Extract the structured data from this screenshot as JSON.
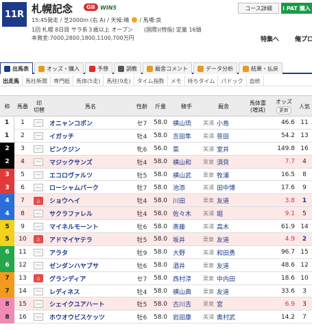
{
  "race": {
    "number": "11R",
    "title": "札幌記念",
    "grade": "GII",
    "win5": "WIN5",
    "meta_line1": "15:45発走 / 芝2000m (右 A) / 天候:晴",
    "meta_weather_tail": "/ 馬場:良",
    "meta_line2": "1回 札幌 8日目 サラ系３歳以上 オープン　　(国際)(特指) 定量 16頭",
    "meta_line3": "本賞金:7000,2800,1800,1100,700万円"
  },
  "header_buttons": {
    "course": "コース詳細",
    "ipat": "i PAT 購入"
  },
  "header_links": {
    "tokusyu": "特集へ",
    "ore": "俺プロ"
  },
  "tabs": [
    {
      "label": "出馬表",
      "icon": "table-icon",
      "color": "#1d3a8a",
      "active": true
    },
    {
      "label": "オッズ・購入",
      "icon": "odds-icon",
      "color": "#e89a1b",
      "active": false
    },
    {
      "label": "予想",
      "icon": "target-icon",
      "color": "#d92e2e",
      "active": false
    },
    {
      "label": "調教",
      "icon": "stopwatch-icon",
      "color": "#555555",
      "active": false
    },
    {
      "label": "厩舎コメント",
      "icon": "comment-icon",
      "color": "#e89a1b",
      "active": false
    },
    {
      "label": "データ分析",
      "icon": "chart-icon",
      "color": "#e89a1b",
      "active": false
    },
    {
      "label": "結果・払戻",
      "icon": "coin-icon",
      "color": "#e89a1b",
      "active": false
    }
  ],
  "subtabs": [
    "出走馬",
    "馬柱新聞",
    "専門紙",
    "馬体(5走)",
    "馬柱(9走)",
    "タイム指数",
    "メモ",
    "持ちタイム",
    "パドック",
    "血統"
  ],
  "columns": {
    "waku": "枠",
    "uma": "馬番",
    "mark": "印",
    "mark_sub": "切替",
    "name": "馬名",
    "sex": "性齢",
    "weight": "斤量",
    "jockey": "騎手",
    "stable": "厩舎",
    "body": "馬体重",
    "body_sub": "(増減)",
    "odds": "オッズ",
    "odds_btn": "更新",
    "pop": "人気"
  },
  "colors": {
    "waku": [
      "#ffffff",
      "#000000",
      "#e03a3a",
      "#2a6ed8",
      "#f2d21b",
      "#24a64a",
      "#f29a1b",
      "#f08cb4"
    ],
    "waku_text": [
      "#222222",
      "#ffffff",
      "#ffffff",
      "#ffffff",
      "#222222",
      "#ffffff",
      "#222222",
      "#222222"
    ]
  },
  "horses": [
    {
      "waku": 1,
      "uma": "1",
      "name": "オニャンコポン",
      "sex": "セ7",
      "wt": "58.0",
      "jockey": "横山琉",
      "aff": "美浦",
      "trainer": "小島",
      "odds": "46.6",
      "pop": "11",
      "hl": false,
      "priority": false,
      "hot": false
    },
    {
      "waku": 1,
      "uma": "2",
      "name": "イガッチ",
      "sex": "牡4",
      "wt": "58.0",
      "jockey": "吉田隼",
      "aff": "美浦",
      "trainer": "笹田",
      "odds": "54.2",
      "pop": "13",
      "hl": false,
      "priority": false,
      "hot": false
    },
    {
      "waku": 2,
      "uma": "3",
      "name": "ピンクジン",
      "sex": "牝6",
      "wt": "56.0",
      "jockey": "菜",
      "aff": "美浦",
      "trainer": "室井",
      "odds": "149.8",
      "pop": "16",
      "hl": false,
      "priority": false,
      "hot": false
    },
    {
      "waku": 2,
      "uma": "4",
      "name": "マジックサンズ",
      "sex": "牡4",
      "wt": "58.0",
      "jockey": "横山和",
      "aff": "栗東",
      "trainer": "須貝",
      "odds": "7.7",
      "pop": "4",
      "hl": true,
      "priority": false,
      "hot": true
    },
    {
      "waku": 3,
      "uma": "5",
      "name": "エコロヴァルツ",
      "sex": "牡5",
      "wt": "58.0",
      "jockey": "横山武",
      "aff": "栗東",
      "trainer": "牧浦",
      "odds": "16.5",
      "pop": "8",
      "hl": false,
      "priority": false,
      "hot": false
    },
    {
      "waku": 3,
      "uma": "6",
      "name": "ローシャムパーク",
      "sex": "牡7",
      "wt": "58.0",
      "jockey": "池添",
      "aff": "美浦",
      "trainer": "田中博",
      "odds": "17.6",
      "pop": "9",
      "hl": false,
      "priority": false,
      "hot": false
    },
    {
      "waku": 4,
      "uma": "7",
      "name": "ショウヘイ",
      "sex": "牡4",
      "wt": "58.0",
      "jockey": "川田",
      "aff": "栗東",
      "trainer": "友道",
      "odds": "3.8",
      "pop": "1",
      "hl": true,
      "priority": true,
      "hot": true
    },
    {
      "waku": 4,
      "uma": "8",
      "name": "サクラファレル",
      "sex": "牡4",
      "wt": "58.0",
      "jockey": "佐々木",
      "aff": "美浦",
      "trainer": "堀",
      "odds": "9.1",
      "pop": "5",
      "hl": true,
      "priority": false,
      "hot": true
    },
    {
      "waku": 5,
      "uma": "9",
      "name": "マイネルモーント",
      "sex": "牡6",
      "wt": "58.0",
      "jockey": "斎藤",
      "aff": "美浦",
      "trainer": "高木",
      "odds": "61.9",
      "pop": "14",
      "hl": false,
      "priority": false,
      "hot": false
    },
    {
      "waku": 5,
      "uma": "10",
      "name": "アドマイヤテラ",
      "sex": "牡5",
      "wt": "58.0",
      "jockey": "坂井",
      "aff": "栗東",
      "trainer": "友道",
      "odds": "4.9",
      "pop": "2",
      "hl": true,
      "priority": true,
      "hot": true
    },
    {
      "waku": 6,
      "uma": "11",
      "name": "アラタ",
      "sex": "牡9",
      "wt": "58.0",
      "jockey": "大野",
      "aff": "美浦",
      "trainer": "和田勇",
      "odds": "96.7",
      "pop": "15",
      "hl": false,
      "priority": false,
      "hot": false
    },
    {
      "waku": 6,
      "uma": "12",
      "name": "ゼンダンハヤブサ",
      "sex": "牡6",
      "wt": "58.0",
      "jockey": "酒井",
      "aff": "栗東",
      "trainer": "友道",
      "odds": "48.6",
      "pop": "12",
      "hl": false,
      "priority": false,
      "hot": false
    },
    {
      "waku": 7,
      "uma": "13",
      "name": "グランディア",
      "sex": "セ7",
      "wt": "58.0",
      "jockey": "西村淳",
      "aff": "栗東",
      "trainer": "中内田",
      "odds": "18.6",
      "pop": "10",
      "hl": false,
      "priority": true,
      "hot": false
    },
    {
      "waku": 7,
      "uma": "14",
      "name": "レディネス",
      "sex": "牡4",
      "wt": "58.0",
      "jockey": "横山典",
      "aff": "栗東",
      "trainer": "友道",
      "odds": "33.6",
      "pop": "3",
      "hl": false,
      "priority": false,
      "hot": false
    },
    {
      "waku": 8,
      "uma": "15",
      "name": "シェイクユアハート",
      "sex": "牡5",
      "wt": "58.0",
      "jockey": "古川吉",
      "aff": "栗東",
      "trainer": "宮",
      "odds": "6.9",
      "pop": "3",
      "hl": true,
      "priority": false,
      "hot": true
    },
    {
      "waku": 8,
      "uma": "16",
      "name": "ホウオウビスケッツ",
      "sex": "牡6",
      "wt": "58.0",
      "jockey": "岩田康",
      "aff": "美浦",
      "trainer": "奥村武",
      "odds": "14.2",
      "pop": "7",
      "hl": false,
      "priority": false,
      "hot": false
    }
  ]
}
